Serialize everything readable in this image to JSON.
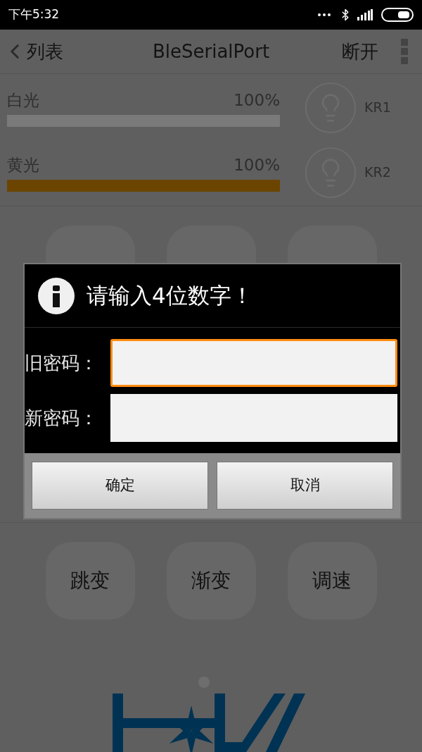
{
  "status_bar": {
    "time": "下午5:32"
  },
  "nav": {
    "back_label": "列表",
    "title": "BleSerialPort",
    "action": "断开"
  },
  "channels": [
    {
      "name": "白光",
      "reading": "100%",
      "level": 1,
      "color": "#7a7a7a",
      "switch_label": "KR1"
    },
    {
      "name": "黄光",
      "reading": "100%",
      "level": 1,
      "color": "#6b4500",
      "switch_label": "KR2"
    }
  ],
  "effect_buttons": [
    "跳变",
    "渐变",
    "调速"
  ],
  "dialog": {
    "title": "请输入4位数字！",
    "fields": [
      {
        "label": "旧密码：",
        "focused": true
      },
      {
        "label": "新密码：",
        "focused": false
      }
    ],
    "buttons": [
      "确定",
      "取消"
    ]
  }
}
